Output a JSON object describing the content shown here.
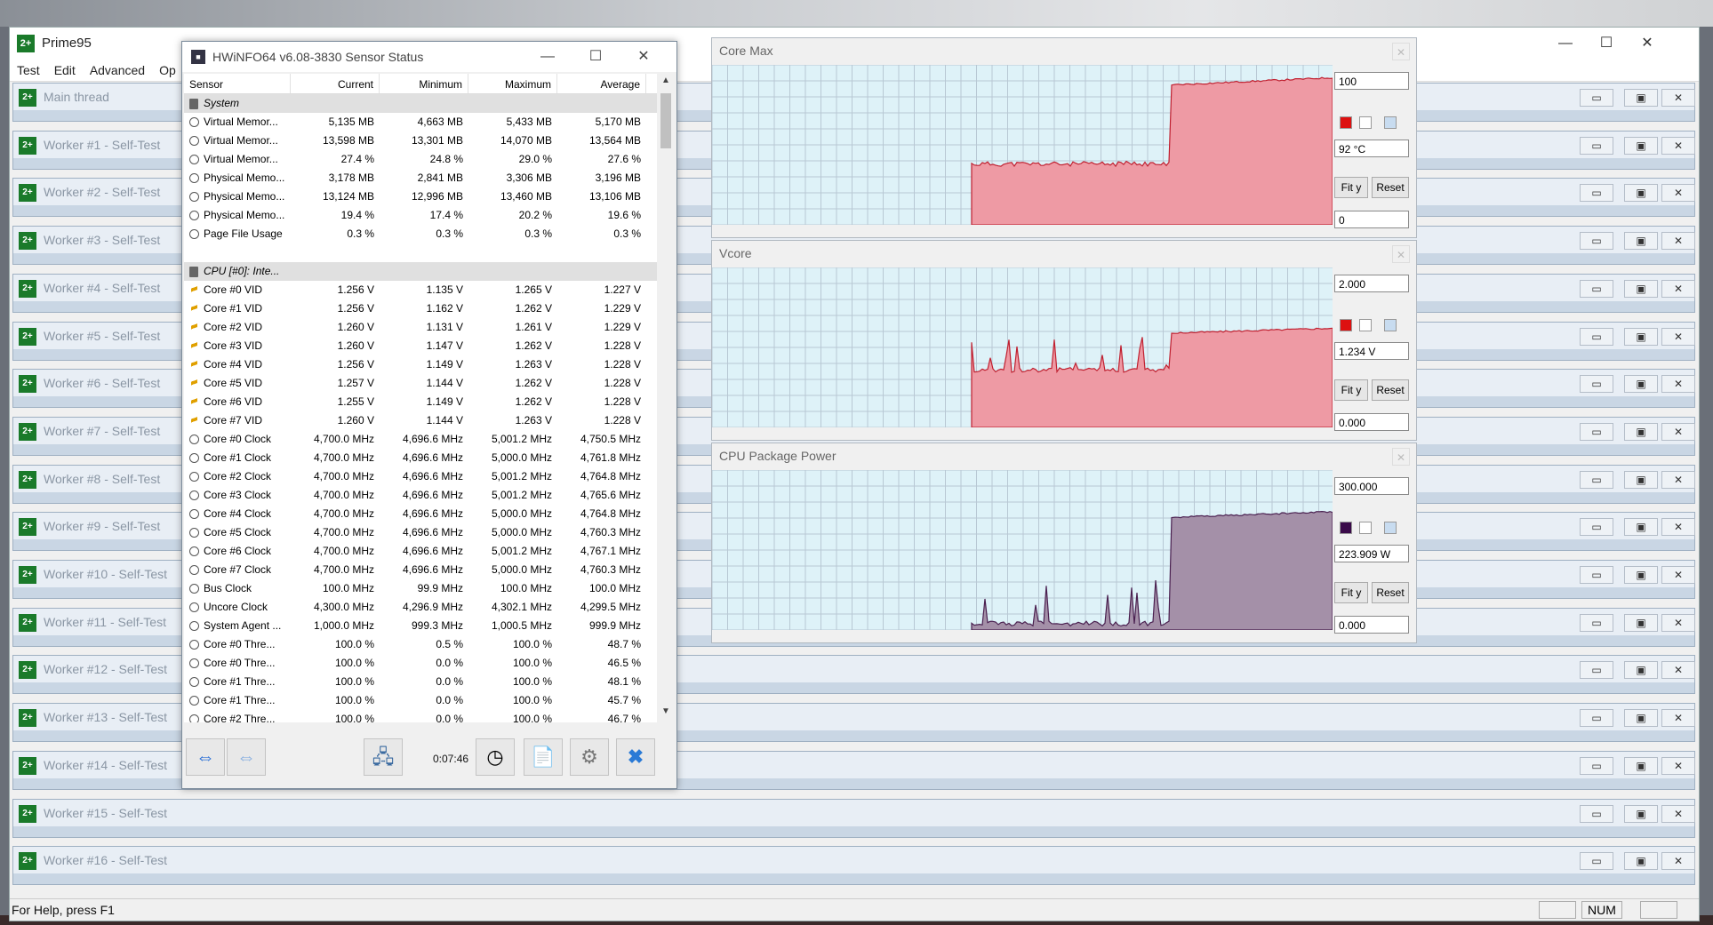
{
  "prime95": {
    "title": "Prime95",
    "menu": [
      "Test",
      "Edit",
      "Advanced",
      "Op"
    ],
    "window_controls": {
      "minimize": "—",
      "maximize": "☐",
      "close": "✕"
    },
    "children": [
      "Main thread",
      "Worker #1 - Self-Test",
      "Worker #2 - Self-Test",
      "Worker #3 - Self-Test",
      "Worker #4 - Self-Test",
      "Worker #5 - Self-Test",
      "Worker #6 - Self-Test",
      "Worker #7 - Self-Test",
      "Worker #8 - Self-Test",
      "Worker #9 - Self-Test",
      "Worker #10 - Self-Test",
      "Worker #11 - Self-Test",
      "Worker #12 - Self-Test",
      "Worker #13 - Self-Test",
      "Worker #14 - Self-Test",
      "Worker #15 - Self-Test",
      "Worker #16 - Self-Test"
    ],
    "child_icon_text": "2+",
    "status_help": "For Help, press F1",
    "status_num": "NUM"
  },
  "hwinfo": {
    "title": "HWiNFO64 v6.08-3830 Sensor Status",
    "columns": [
      "Sensor",
      "Current",
      "Minimum",
      "Maximum",
      "Average"
    ],
    "rows": [
      {
        "type": "group",
        "name": "System",
        "icon": "chip"
      },
      {
        "name": "Virtual Memor...",
        "cur": "5,135 MB",
        "min": "4,663 MB",
        "max": "5,433 MB",
        "avg": "5,170 MB",
        "icon": "gauge"
      },
      {
        "name": "Virtual Memor...",
        "cur": "13,598 MB",
        "min": "13,301 MB",
        "max": "14,070 MB",
        "avg": "13,564 MB",
        "icon": "gauge"
      },
      {
        "name": "Virtual Memor...",
        "cur": "27.4 %",
        "min": "24.8 %",
        "max": "29.0 %",
        "avg": "27.6 %",
        "icon": "gauge"
      },
      {
        "name": "Physical Memo...",
        "cur": "3,178 MB",
        "min": "2,841 MB",
        "max": "3,306 MB",
        "avg": "3,196 MB",
        "icon": "gauge"
      },
      {
        "name": "Physical Memo...",
        "cur": "13,124 MB",
        "min": "12,996 MB",
        "max": "13,460 MB",
        "avg": "13,106 MB",
        "icon": "gauge"
      },
      {
        "name": "Physical Memo...",
        "cur": "19.4 %",
        "min": "17.4 %",
        "max": "20.2 %",
        "avg": "19.6 %",
        "icon": "gauge"
      },
      {
        "name": "Page File Usage",
        "cur": "0.3 %",
        "min": "0.3 %",
        "max": "0.3 %",
        "avg": "0.3 %",
        "icon": "gauge"
      },
      {
        "type": "blank"
      },
      {
        "type": "group",
        "name": "CPU [#0]: Inte...",
        "icon": "chip"
      },
      {
        "name": "Core #0 VID",
        "cur": "1.256 V",
        "min": "1.135 V",
        "max": "1.265 V",
        "avg": "1.227 V",
        "icon": "volt"
      },
      {
        "name": "Core #1 VID",
        "cur": "1.256 V",
        "min": "1.162 V",
        "max": "1.262 V",
        "avg": "1.229 V",
        "icon": "volt"
      },
      {
        "name": "Core #2 VID",
        "cur": "1.260 V",
        "min": "1.131 V",
        "max": "1.261 V",
        "avg": "1.229 V",
        "icon": "volt"
      },
      {
        "name": "Core #3 VID",
        "cur": "1.260 V",
        "min": "1.147 V",
        "max": "1.262 V",
        "avg": "1.228 V",
        "icon": "volt"
      },
      {
        "name": "Core #4 VID",
        "cur": "1.256 V",
        "min": "1.149 V",
        "max": "1.263 V",
        "avg": "1.228 V",
        "icon": "volt"
      },
      {
        "name": "Core #5 VID",
        "cur": "1.257 V",
        "min": "1.144 V",
        "max": "1.262 V",
        "avg": "1.228 V",
        "icon": "volt"
      },
      {
        "name": "Core #6 VID",
        "cur": "1.255 V",
        "min": "1.149 V",
        "max": "1.262 V",
        "avg": "1.228 V",
        "icon": "volt"
      },
      {
        "name": "Core #7 VID",
        "cur": "1.260 V",
        "min": "1.144 V",
        "max": "1.263 V",
        "avg": "1.228 V",
        "icon": "volt"
      },
      {
        "name": "Core #0 Clock",
        "cur": "4,700.0 MHz",
        "min": "4,696.6 MHz",
        "max": "5,001.2 MHz",
        "avg": "4,750.5 MHz",
        "icon": "gauge"
      },
      {
        "name": "Core #1 Clock",
        "cur": "4,700.0 MHz",
        "min": "4,696.6 MHz",
        "max": "5,000.0 MHz",
        "avg": "4,761.8 MHz",
        "icon": "gauge"
      },
      {
        "name": "Core #2 Clock",
        "cur": "4,700.0 MHz",
        "min": "4,696.6 MHz",
        "max": "5,001.2 MHz",
        "avg": "4,764.8 MHz",
        "icon": "gauge"
      },
      {
        "name": "Core #3 Clock",
        "cur": "4,700.0 MHz",
        "min": "4,696.6 MHz",
        "max": "5,001.2 MHz",
        "avg": "4,765.6 MHz",
        "icon": "gauge"
      },
      {
        "name": "Core #4 Clock",
        "cur": "4,700.0 MHz",
        "min": "4,696.6 MHz",
        "max": "5,000.0 MHz",
        "avg": "4,764.8 MHz",
        "icon": "gauge"
      },
      {
        "name": "Core #5 Clock",
        "cur": "4,700.0 MHz",
        "min": "4,696.6 MHz",
        "max": "5,000.0 MHz",
        "avg": "4,760.3 MHz",
        "icon": "gauge"
      },
      {
        "name": "Core #6 Clock",
        "cur": "4,700.0 MHz",
        "min": "4,696.6 MHz",
        "max": "5,001.2 MHz",
        "avg": "4,767.1 MHz",
        "icon": "gauge"
      },
      {
        "name": "Core #7 Clock",
        "cur": "4,700.0 MHz",
        "min": "4,696.6 MHz",
        "max": "5,000.0 MHz",
        "avg": "4,760.3 MHz",
        "icon": "gauge"
      },
      {
        "name": "Bus Clock",
        "cur": "100.0 MHz",
        "min": "99.9 MHz",
        "max": "100.0 MHz",
        "avg": "100.0 MHz",
        "icon": "gauge"
      },
      {
        "name": "Uncore Clock",
        "cur": "4,300.0 MHz",
        "min": "4,296.9 MHz",
        "max": "4,302.1 MHz",
        "avg": "4,299.5 MHz",
        "icon": "gauge"
      },
      {
        "name": "System Agent ...",
        "cur": "1,000.0 MHz",
        "min": "999.3 MHz",
        "max": "1,000.5 MHz",
        "avg": "999.9 MHz",
        "icon": "gauge"
      },
      {
        "name": "Core #0 Thre...",
        "cur": "100.0 %",
        "min": "0.5 %",
        "max": "100.0 %",
        "avg": "48.7 %",
        "icon": "gauge"
      },
      {
        "name": "Core #0 Thre...",
        "cur": "100.0 %",
        "min": "0.0 %",
        "max": "100.0 %",
        "avg": "46.5 %",
        "icon": "gauge"
      },
      {
        "name": "Core #1 Thre...",
        "cur": "100.0 %",
        "min": "0.0 %",
        "max": "100.0 %",
        "avg": "48.1 %",
        "icon": "gauge"
      },
      {
        "name": "Core #1 Thre...",
        "cur": "100.0 %",
        "min": "0.0 %",
        "max": "100.0 %",
        "avg": "45.7 %",
        "icon": "gauge"
      },
      {
        "name": "Core #2 Thre...",
        "cur": "100.0 %",
        "min": "0.0 %",
        "max": "100.0 %",
        "avg": "46.7 %",
        "icon": "gauge"
      }
    ],
    "timer": "0:07:46"
  },
  "graphs": [
    {
      "title": "Core Max",
      "top": "100",
      "value": "92 °C",
      "bottom": "0",
      "fit": "Fit y",
      "reset": "Reset",
      "color": "#ee9aa4",
      "line": "#c02030",
      "swatch": "#dd1111",
      "baseline": 0.38,
      "high": 0.92
    },
    {
      "title": "Vcore",
      "top": "2.000",
      "value": "1.234 V",
      "bottom": "0.000",
      "fit": "Fit y",
      "reset": "Reset",
      "color": "#ee9aa4",
      "line": "#c02030",
      "swatch": "#dd1111",
      "baseline": 0.36,
      "high": 0.62
    },
    {
      "title": "CPU Package Power",
      "top": "300.000",
      "value": "223.909 W",
      "bottom": "0.000",
      "fit": "Fit y",
      "reset": "Reset",
      "color": "#a490a8",
      "line": "#4a2050",
      "swatch": "#3a0a4a",
      "baseline": 0.04,
      "high": 0.74
    }
  ]
}
